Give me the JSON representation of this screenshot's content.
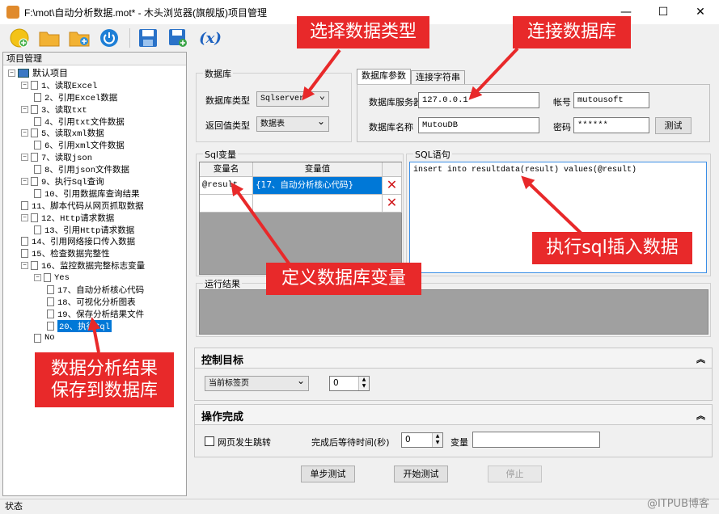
{
  "window": {
    "title": "F:\\mot\\自动分析数据.mot* - 木头浏览器(旗舰版)项目管理",
    "minimize": "—",
    "maximize": "☐",
    "close": "✕"
  },
  "toolbar": {
    "icons": [
      "new-project-icon",
      "open-folder-icon",
      "add-folder-icon",
      "power-icon",
      "save-icon",
      "save-as-icon",
      "variable-x-icon"
    ],
    "x_label": "(x)"
  },
  "project_panel": {
    "header": "项目管理",
    "root": "默认项目",
    "items": [
      {
        "label": "1、读取Excel",
        "level": 1,
        "toggle": "−"
      },
      {
        "label": "2、引用Excel数据",
        "level": 2,
        "toggle": ""
      },
      {
        "label": "3、读取txt",
        "level": 1,
        "toggle": "−"
      },
      {
        "label": "4、引用txt文件数据",
        "level": 2,
        "toggle": ""
      },
      {
        "label": "5、读取xml数据",
        "level": 1,
        "toggle": "−"
      },
      {
        "label": "6、引用xml文件数据",
        "level": 2,
        "toggle": ""
      },
      {
        "label": "7、读取json",
        "level": 1,
        "toggle": "−"
      },
      {
        "label": "8、引用json文件数据",
        "level": 2,
        "toggle": ""
      },
      {
        "label": "9、执行Sql查询",
        "level": 1,
        "toggle": "−"
      },
      {
        "label": "10、引用数据库查询结果",
        "level": 2,
        "toggle": ""
      },
      {
        "label": "11、脚本代码从网页抓取数据",
        "level": 1,
        "toggle": ""
      },
      {
        "label": "12、Http请求数据",
        "level": 1,
        "toggle": "−"
      },
      {
        "label": "13、引用Http请求数据",
        "level": 2,
        "toggle": ""
      },
      {
        "label": "14、引用网络接口传入数据",
        "level": 1,
        "toggle": ""
      },
      {
        "label": "15、检查数据完整性",
        "level": 1,
        "toggle": ""
      },
      {
        "label": "16、监控数据完整标志变量",
        "level": 1,
        "toggle": "−"
      },
      {
        "label": "Yes",
        "level": 2,
        "toggle": "−"
      },
      {
        "label": "17、自动分析核心代码",
        "level": 3,
        "toggle": ""
      },
      {
        "label": "18、可视化分析图表",
        "level": 3,
        "toggle": ""
      },
      {
        "label": "19、保存分析结果文件",
        "level": 3,
        "toggle": ""
      },
      {
        "label": "20、执行Sql",
        "level": 3,
        "toggle": "",
        "selected": true
      },
      {
        "label": "No",
        "level": 2,
        "toggle": ""
      }
    ]
  },
  "database": {
    "group_title": "数据库",
    "db_type_label": "数据库类型",
    "db_type_value": "Sqlserver",
    "return_type_label": "返回值类型",
    "return_type_value": "数据表",
    "tabs": [
      "数据库参数",
      "连接字符串"
    ],
    "server_label": "数据库服务器",
    "server_value": "127.0.0.1",
    "account_label": "帐号",
    "account_value": "mutousoft",
    "dbname_label": "数据库名称",
    "dbname_value": "MutouDB",
    "password_label": "密码",
    "password_value": "******",
    "test_button": "测试"
  },
  "sql_vars": {
    "group_title": "Sql变量",
    "col_name": "变量名",
    "col_value": "变量值",
    "rows": [
      {
        "name": "@result",
        "value": "{17、自动分析核心代码}"
      },
      {
        "name": "",
        "value": ""
      }
    ]
  },
  "sql_statement": {
    "group_title": "SQL语句",
    "text": "insert into resultdata(result) values(@result)"
  },
  "run_result": {
    "group_title": "运行结果"
  },
  "control_target": {
    "title": "控制目标",
    "collapse": "»",
    "combo_value": "当前标签页",
    "spin_value": "0"
  },
  "operation_done": {
    "title": "操作完成",
    "collapse": "»",
    "checkbox_label": "网页发生跳转",
    "wait_label": "完成后等待时间(秒)",
    "wait_value": "0",
    "var_label": "变量",
    "var_value": ""
  },
  "actions": {
    "step_test": "单步测试",
    "start_test": "开始测试",
    "stop": "停止"
  },
  "status": {
    "text": "状态",
    "watermark": "@ITPUB博客"
  },
  "callouts": {
    "select_db_type": "选择数据类型",
    "connect_db": "连接数据库",
    "exec_sql_insert": "执行sql插入数据",
    "define_db_var": "定义数据库变量",
    "save_result": "数据分析结果\n保存到数据库"
  },
  "colors": {
    "accent": "#0078d7",
    "callout": "#e8292a"
  }
}
